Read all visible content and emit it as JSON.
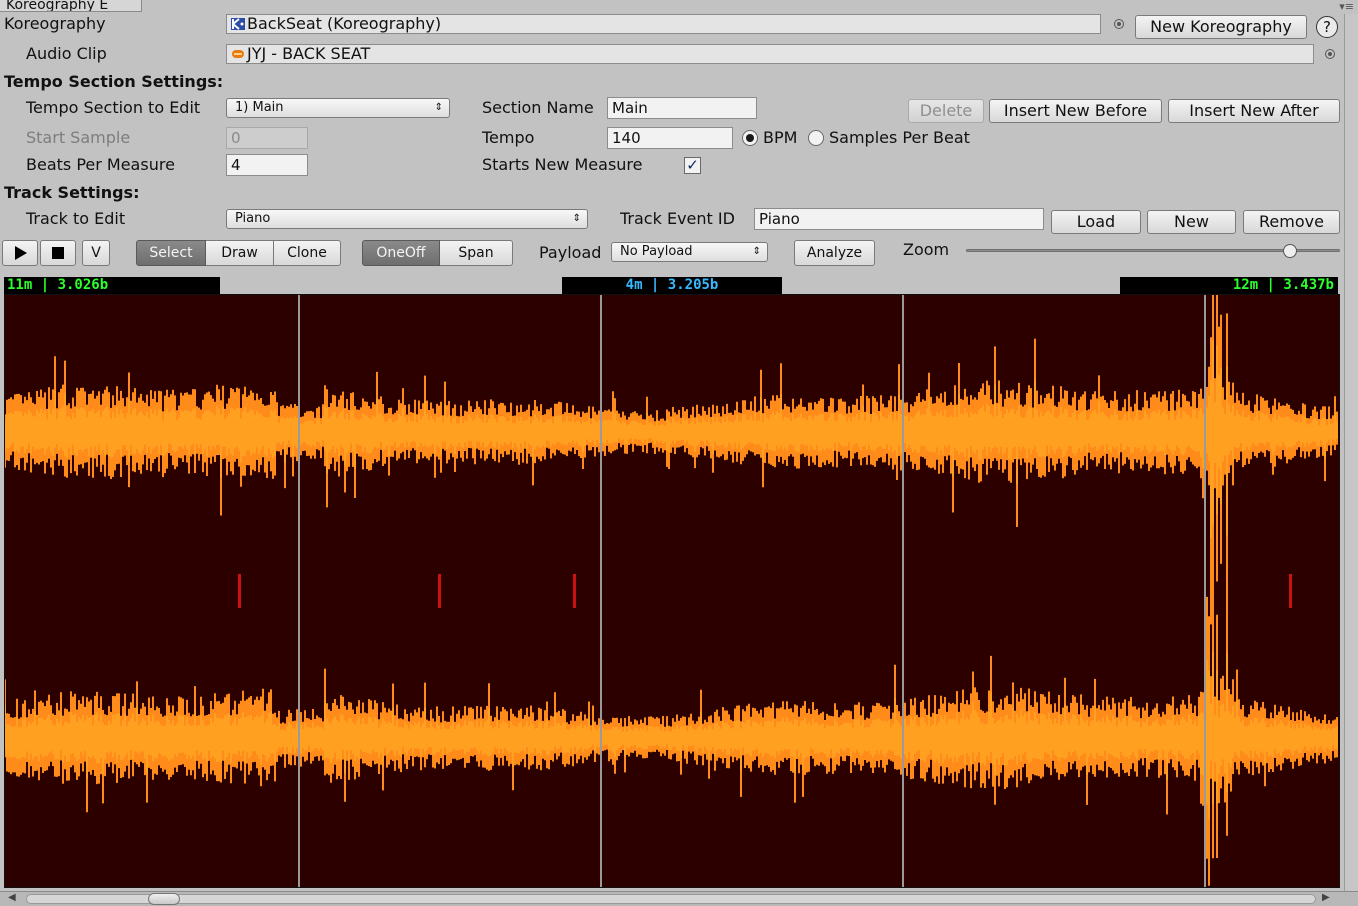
{
  "window": {
    "tab_title": "Koreography E",
    "menu_glyph": "▾≡"
  },
  "koreography": {
    "label": "Koreography",
    "value": "BackSeat (Koreography)",
    "new_button": "New Koreography",
    "help": "?"
  },
  "audio_clip": {
    "label": "Audio Clip",
    "value": "JYJ - BACK SEAT"
  },
  "tempo_settings": {
    "header": "Tempo Section Settings:",
    "section_to_edit_label": "Tempo Section to Edit",
    "section_to_edit_value": "1) Main",
    "start_sample_label": "Start Sample",
    "start_sample_value": "0",
    "beats_per_measure_label": "Beats Per Measure",
    "beats_per_measure_value": "4",
    "section_name_label": "Section Name",
    "section_name_value": "Main",
    "tempo_label": "Tempo",
    "tempo_value": "140",
    "bpm_label": "BPM",
    "samples_per_beat_label": "Samples Per Beat",
    "bpm_selected": true,
    "starts_new_measure_label": "Starts New Measure",
    "starts_new_measure_checked": true,
    "delete_button": "Delete",
    "insert_before_button": "Insert New Before",
    "insert_after_button": "Insert New After"
  },
  "track_settings": {
    "header": "Track Settings:",
    "track_to_edit_label": "Track to Edit",
    "track_to_edit_value": "Piano",
    "event_id_label": "Track Event ID",
    "event_id_value": "Piano",
    "load_button": "Load",
    "new_button": "New",
    "remove_button": "Remove"
  },
  "toolbar": {
    "play_icon": "play-icon",
    "stop_icon": "stop-icon",
    "v_button": "V",
    "modes": [
      "Select",
      "Draw",
      "Clone"
    ],
    "active_mode": "Select",
    "event_types": [
      "OneOff",
      "Span"
    ],
    "active_event_type": "OneOff",
    "payload_label": "Payload",
    "payload_value": "No Payload",
    "analyze_button": "Analyze",
    "zoom_label": "Zoom",
    "zoom_level": 0.88
  },
  "readouts": {
    "left": "11m  |  3.026b",
    "center": "4m  |  3.205b",
    "right": "12m  |  3.437b"
  },
  "colors": {
    "wave_bg": "#2d0000",
    "wave_fill": "#ff8c1a",
    "wave_fill_light": "#ffa020",
    "beat_line": "#9a9a9a",
    "event_marker": "#cc1111",
    "readout_green": "#2cff2c",
    "readout_blue": "#38b8ff"
  }
}
